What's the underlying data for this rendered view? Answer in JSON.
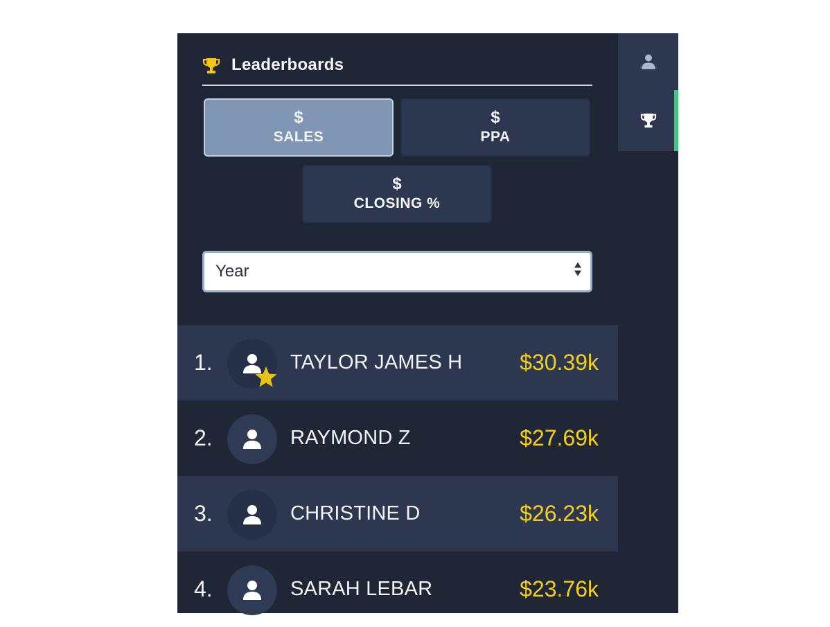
{
  "header": {
    "title": "Leaderboards",
    "icon": "trophy-icon"
  },
  "metrics": [
    {
      "symbol": "$",
      "label": "SALES",
      "active": true
    },
    {
      "symbol": "$",
      "label": "PPA",
      "active": false
    },
    {
      "symbol": "$",
      "label": "CLOSING %",
      "active": false
    }
  ],
  "period_select": {
    "value": "Year"
  },
  "leaderboard": [
    {
      "rank": "1.",
      "name": "TAYLOR JAMES H",
      "amount": "$30.39k",
      "badge": "star-icon"
    },
    {
      "rank": "2.",
      "name": "RAYMOND Z",
      "amount": "$27.69k"
    },
    {
      "rank": "3.",
      "name": "CHRISTINE D",
      "amount": "$26.23k"
    },
    {
      "rank": "4.",
      "name": "SARAH LEBAR",
      "amount": "$23.76k"
    }
  ],
  "side_rail": {
    "tabs": [
      {
        "icon": "user-icon",
        "active": false
      },
      {
        "icon": "trophy-icon",
        "active": true
      }
    ]
  },
  "colors": {
    "panel_bg": "#1f2636",
    "row_alt_bg": "#2d3850",
    "amount": "#f5cf16",
    "trophy": "#f5c518",
    "active_indicator": "#3fc87a",
    "active_button": "#7f95b4"
  }
}
